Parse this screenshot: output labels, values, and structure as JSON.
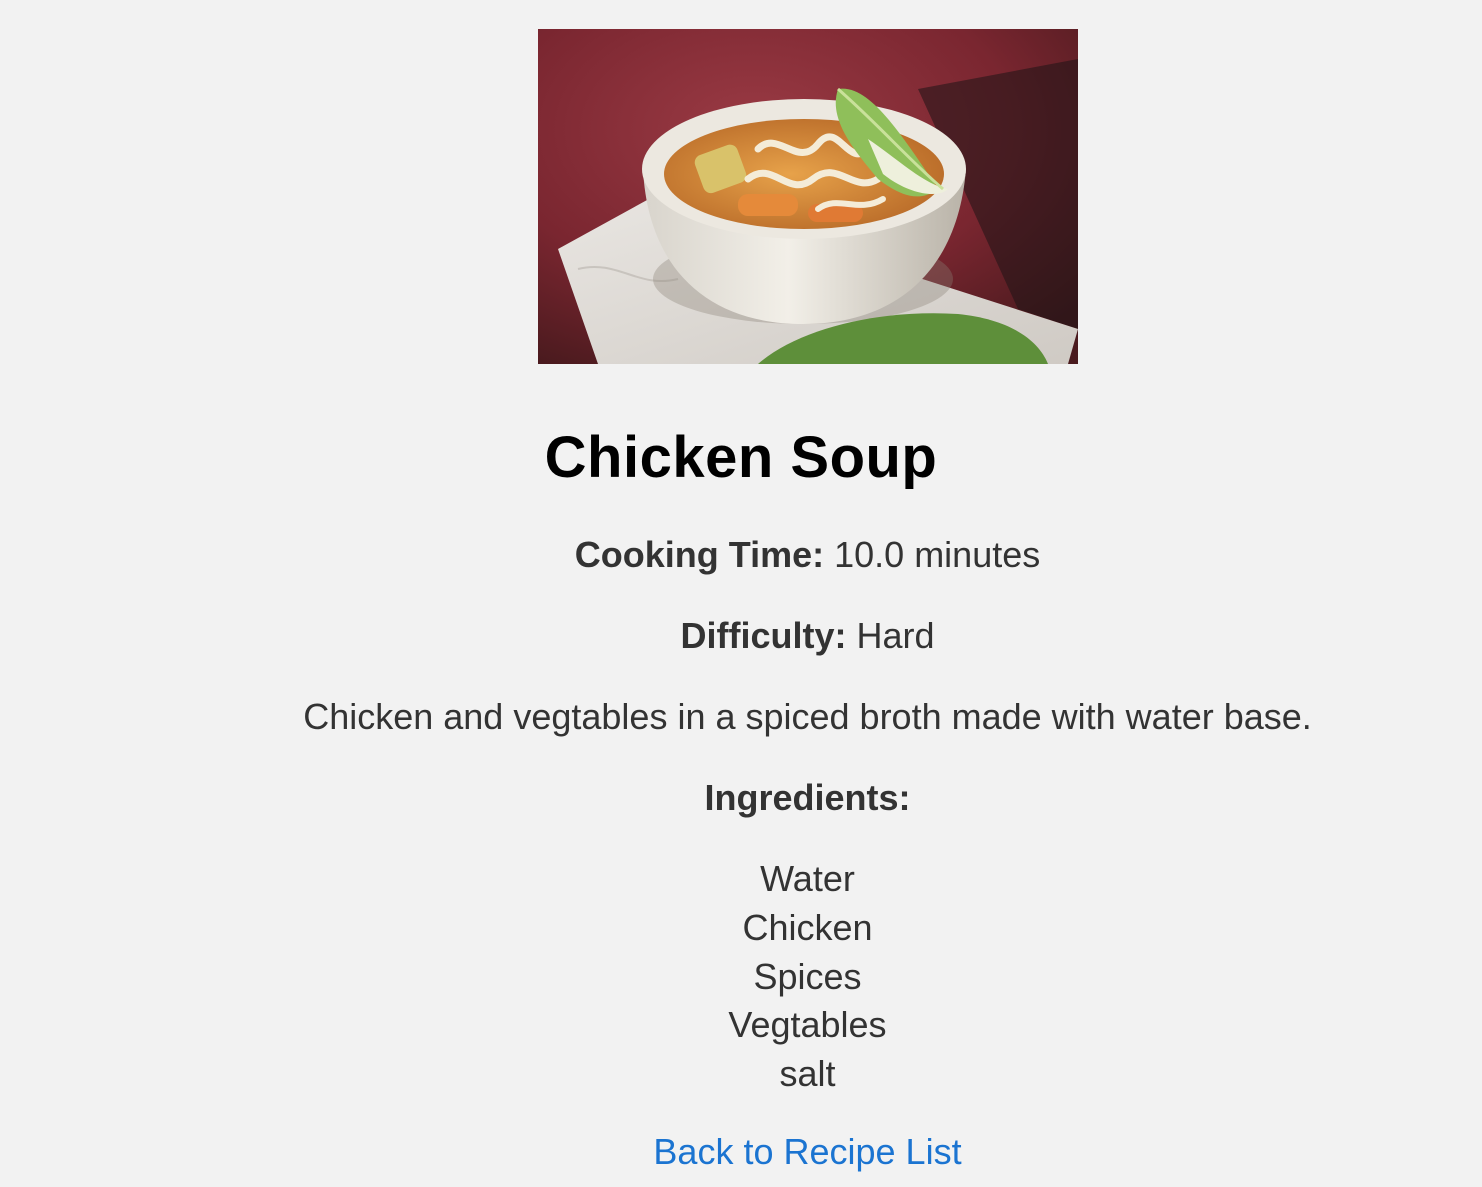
{
  "recipe": {
    "image_alt": "Chicken Soup",
    "title": "Chicken Soup",
    "cooking_time_label": "Cooking Time:",
    "cooking_time_value": "10.0 minutes",
    "difficulty_label": "Difficulty:",
    "difficulty_value": "Hard",
    "description": "Chicken and vegtables in a spiced broth made with water base.",
    "ingredients_heading": "Ingredients:",
    "ingredients": [
      "Water",
      "Chicken",
      "Spices",
      "Vegtables",
      "salt"
    ]
  },
  "nav": {
    "back_link": "Back to Recipe List"
  },
  "colors": {
    "background": "#f2f2f2",
    "text": "#333333",
    "title": "#000000",
    "link": "#1b74d1"
  }
}
